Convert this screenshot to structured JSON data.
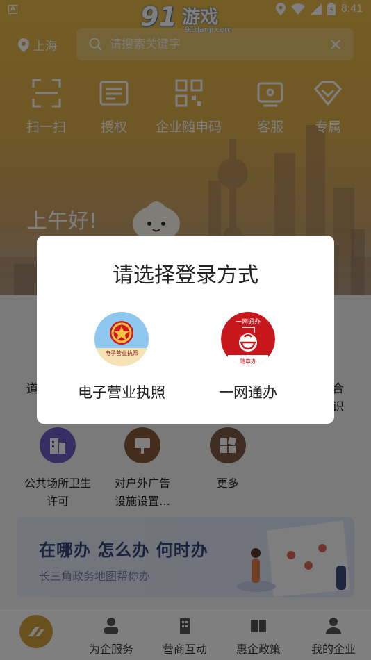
{
  "status_bar": {
    "time": "8:41",
    "badge": "A"
  },
  "brand": {
    "number": "91",
    "text": "游戏",
    "domain": "91danji.com"
  },
  "location": {
    "city": "上海"
  },
  "search": {
    "placeholder": "请搜索关键字",
    "clear_icon": "close-icon"
  },
  "quick_actions": [
    {
      "label": "扫一扫",
      "icon": "scan-icon"
    },
    {
      "label": "授权",
      "icon": "authorize-icon"
    },
    {
      "label": "企业随申码",
      "icon": "qr-code-icon"
    },
    {
      "label": "客服",
      "icon": "customer-service-icon"
    },
    {
      "label": "专属",
      "icon": "diamond-icon"
    }
  ],
  "greeting": "上午好!",
  "partial_labels": {
    "left_1": "道",
    "right_1": "合",
    "right_2": "识"
  },
  "services": [
    {
      "label": "公共场所卫生许可",
      "icon": "building-icon",
      "color": "#6f5fc6"
    },
    {
      "label": "对户外广告设施设置…",
      "icon": "billboard-icon",
      "color": "#8a5a3c"
    },
    {
      "label": "更多",
      "icon": "grid-icon",
      "color": "#7a5a44"
    }
  ],
  "banner": {
    "title": "在哪办 怎么办 何时办",
    "subtitle": "长三角政务地图帮你办"
  },
  "tabbar": [
    {
      "label": "为企服务",
      "icon": "person-icon"
    },
    {
      "label": "营商互动",
      "icon": "building-tab-icon"
    },
    {
      "label": "惠企政策",
      "icon": "book-icon"
    },
    {
      "label": "我的企业",
      "icon": "user-icon"
    }
  ],
  "dialog": {
    "title": "请选择登录方式",
    "options": [
      {
        "label": "电子营业执照",
        "icon": "national-emblem-icon",
        "logo_text": "电子营业执照"
      },
      {
        "label": "一网通办",
        "icon": "yiwangtongban-logo-icon",
        "logo_text_top": "一网通办",
        "logo_text_bottom": "随申办"
      }
    ]
  },
  "colors": {
    "brand_gold": "#d2a23c",
    "dialog_bg": "#ffffff",
    "logo_red": "#c8161d"
  }
}
